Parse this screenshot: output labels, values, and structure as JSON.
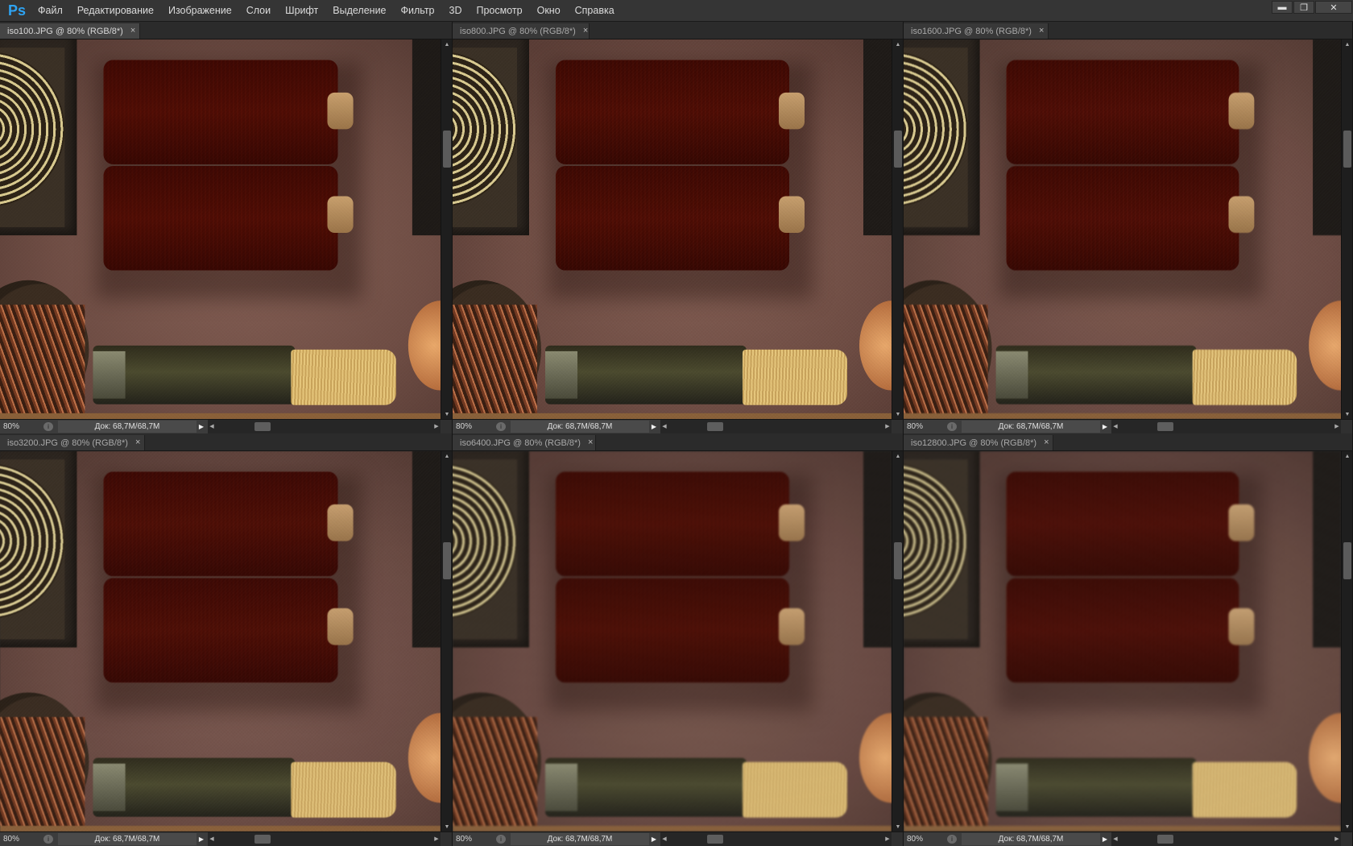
{
  "app": {
    "logo": "Ps"
  },
  "menu": [
    "Файл",
    "Редактирование",
    "Изображение",
    "Слои",
    "Шрифт",
    "Выделение",
    "Фильтр",
    "3D",
    "Просмотр",
    "Окно",
    "Справка"
  ],
  "window_controls": {
    "minimize": "▬",
    "restore": "❐",
    "close": "✕"
  },
  "documents": [
    {
      "tab": "iso100.JPG @ 80% (RGB/8*)",
      "close": "×",
      "zoom": "80%",
      "doc_size": "Док: 68,7M/68,7M",
      "active": true,
      "noise": 0.0
    },
    {
      "tab": "iso800.JPG @ 80% (RGB/8*)",
      "close": "×",
      "zoom": "80%",
      "doc_size": "Док: 68,7M/68,7M",
      "active": false,
      "noise": 0.15
    },
    {
      "tab": "iso1600.JPG @ 80% (RGB/8*)",
      "close": "×",
      "zoom": "80%",
      "doc_size": "Док: 68,7M/68,7M",
      "active": false,
      "noise": 0.25
    },
    {
      "tab": "iso3200.JPG @ 80% (RGB/8*)",
      "close": "×",
      "zoom": "80%",
      "doc_size": "Док: 68,7M/68,7M",
      "active": false,
      "noise": 0.4
    },
    {
      "tab": "iso6400.JPG @ 80% (RGB/8*)",
      "close": "×",
      "zoom": "80%",
      "doc_size": "Док: 68,7M/68,7M",
      "active": false,
      "noise": 0.6
    },
    {
      "tab": "iso12800.JPG @ 80% (RGB/8*)",
      "close": "×",
      "zoom": "80%",
      "doc_size": "Док: 68,7M/68,7M",
      "active": false,
      "noise": 0.85
    }
  ],
  "icons": {
    "info": "i",
    "play": "▶",
    "arrow_up": "▲",
    "arrow_down": "▼",
    "arrow_left": "◀",
    "arrow_right": "▶"
  }
}
